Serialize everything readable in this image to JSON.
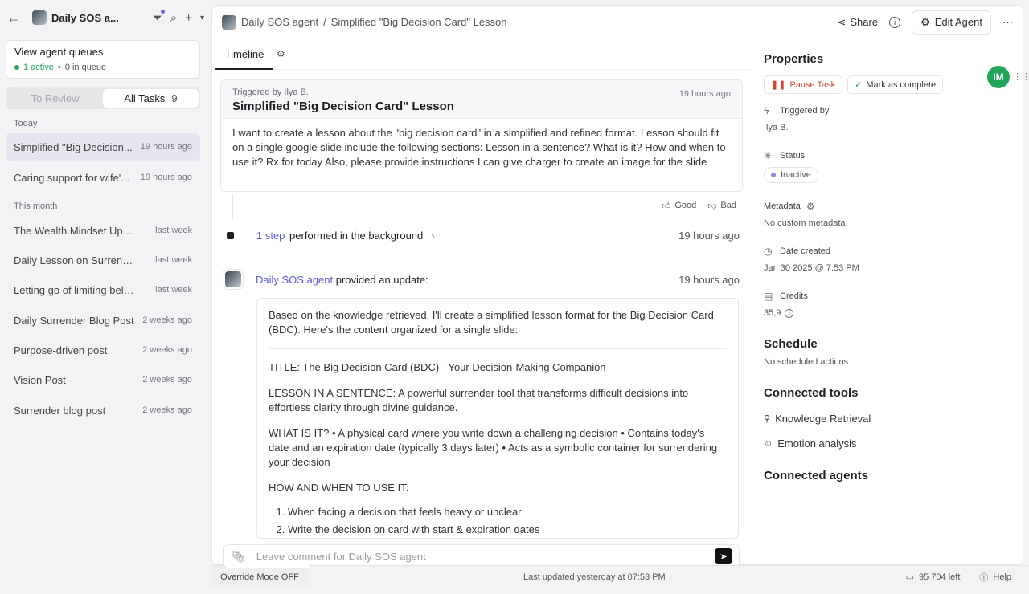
{
  "sidebar": {
    "agent_title": "Daily SOS a...",
    "queue": {
      "title": "View agent queues",
      "active": "1 active",
      "in_queue": "0 in queue"
    },
    "segments": {
      "to_review": "To Review",
      "all_tasks": "All Tasks",
      "all_count": "9"
    },
    "sections": {
      "today": "Today",
      "this_month": "This month"
    },
    "today_tasks": [
      {
        "name": "Simplified \"Big Decision...",
        "time": "19 hours ago"
      },
      {
        "name": "Caring support for wife'...",
        "time": "19 hours ago"
      }
    ],
    "month_tasks": [
      {
        "name": "The Wealth Mindset Upgra...",
        "time": "last week"
      },
      {
        "name": "Daily Lesson on Surrender",
        "time": "last week"
      },
      {
        "name": "Letting go of limiting beliefs",
        "time": "last week"
      },
      {
        "name": "Daily Surrender Blog Post",
        "time": "2 weeks ago"
      },
      {
        "name": "Purpose-driven post",
        "time": "2 weeks ago"
      },
      {
        "name": "Vision Post",
        "time": "2 weeks ago"
      },
      {
        "name": "Surrender blog post",
        "time": "2 weeks ago"
      }
    ],
    "override": "Override Mode OFF"
  },
  "header": {
    "crumb_agent": "Daily SOS agent",
    "crumb_sep": "/",
    "crumb_task": "Simplified \"Big Decision Card\" Lesson",
    "share": "Share",
    "edit_agent": "Edit Agent",
    "more": "···"
  },
  "tabs": {
    "timeline": "Timeline"
  },
  "trigger": {
    "by": "Triggered by Ilya B.",
    "title": "Simplified \"Big Decision Card\" Lesson",
    "time": "19 hours ago",
    "body": "I want to create a lesson about the \"big decision card\" in a simplified and refined format. Lesson should fit on a single google slide include the following sections: Lesson in a sentence? What is it? How and when to use it? Rx for today Also, please provide instructions I can give charger to create an image for the slide"
  },
  "feedback": {
    "good": "Good",
    "bad": "Bad"
  },
  "step": {
    "link": "1 step",
    "text": "performed in the background",
    "time": "19 hours ago"
  },
  "update": {
    "agent": "Daily SOS agent",
    "text": "provided an update:",
    "time": "19 hours ago"
  },
  "response": {
    "intro": "Based on the knowledge retrieved, I'll create a simplified lesson format for the Big Decision Card (BDC). Here's the content organized for a single slide:",
    "title_line": "TITLE: The Big Decision Card (BDC) - Your Decision-Making Companion",
    "lesson_line": "LESSON IN A SENTENCE: A powerful surrender tool that transforms difficult decisions into effortless clarity through divine guidance.",
    "what_line": "WHAT IS IT? • A physical card where you write down a challenging decision • Contains today's date and an expiration date (typically 3 days later) • Acts as a symbolic container for surrendering your decision",
    "how_line": "HOW AND WHEN TO USE IT:",
    "steps": [
      "When facing a decision that feels heavy or unclear",
      "Write the decision on card with start & expiration dates"
    ]
  },
  "comment": {
    "placeholder": "Leave comment for Daily SOS agent"
  },
  "properties": {
    "title": "Properties",
    "pause": "Pause Task",
    "mark": "Mark as complete",
    "triggered_by_label": "Triggered by",
    "triggered_by_value": "Ilya B.",
    "status_label": "Status",
    "status_value": "Inactive",
    "metadata_label": "Metadata",
    "metadata_value": "No custom metadata",
    "date_label": "Date created",
    "date_value": "Jan 30 2025 @ 7:53 PM",
    "credits_label": "Credits",
    "credits_value": "35,9",
    "schedule_title": "Schedule",
    "schedule_value": "No scheduled actions",
    "tools_title": "Connected tools",
    "tools": [
      "Knowledge Retrieval",
      "Emotion analysis"
    ],
    "agents_title": "Connected agents"
  },
  "brand": "IM",
  "footer": {
    "updated": "Last updated yesterday at 07:53 PM",
    "credits_left": "95 704 left",
    "help": "Help"
  },
  "colors": {
    "accent": "#5b5bd6",
    "active": "#22a559",
    "pause": "#d4462e"
  }
}
